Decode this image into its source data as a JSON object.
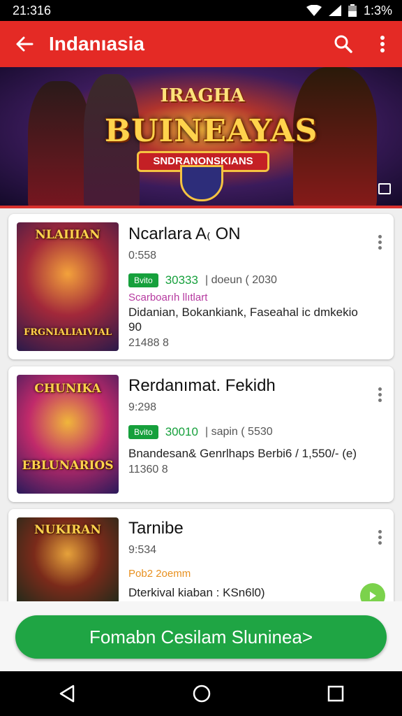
{
  "status_bar": {
    "time": "21:316",
    "battery": "1:3%"
  },
  "app_bar": {
    "title": "Indanıasia"
  },
  "banner": {
    "top_text": "IRAGHA",
    "title": "BUINEAYAS",
    "subtitle": "SNDRANONSKIANS"
  },
  "games": [
    {
      "thumb_text": "NLAIIIAN",
      "thumb_text_bottom": "FRGNIALIAIVIAL",
      "title": "Ncarlara A₍ ON",
      "meta": "0:558",
      "tag": "Bvito",
      "price": "30333",
      "price_note": "| doeun ( 2030",
      "promo": "Scarboarıh llıtlart",
      "description": "Didanian, Bokankiank, Faseahal ic dmkekio 90",
      "footer": "21488 8"
    },
    {
      "thumb_text": "CHUNIKA",
      "thumb_text_bottom": "EBLUNARIOS",
      "title": "Rerdanımat. Fekidh",
      "meta": "9:298",
      "tag": "Bvito",
      "price": "30010",
      "price_note": "| sapin ( 5530",
      "promo": "",
      "description": "Bnandesan& Genrlhaps Berbi6 / 1,550/- (e)",
      "footer": "11360 8"
    },
    {
      "thumb_text": "NUKIRAN",
      "thumb_text_bottom": "",
      "title": "Tarnibe",
      "meta": "9:534",
      "tag": "",
      "price": "",
      "price_note": "",
      "promo": "Pob2 2oemm",
      "description": "Dterkival kiaban : KSn6l0)",
      "footer": ""
    }
  ],
  "cta": {
    "label": "Fomabn Cesilam Slunineа>"
  },
  "colors": {
    "app_bar": "#e42a25",
    "accent_green": "#1fa544",
    "promo_purple": "#b63aa0",
    "promo_orange": "#e8901f"
  }
}
